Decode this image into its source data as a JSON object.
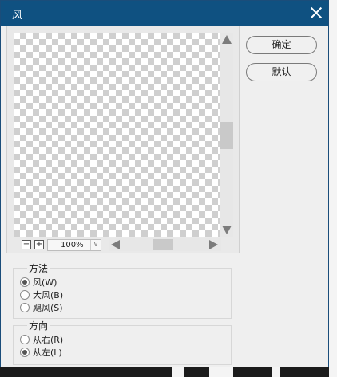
{
  "window": {
    "title": "风"
  },
  "preview": {
    "zoom": "100%",
    "zoom_out_symbol": "−",
    "zoom_in_symbol": "+"
  },
  "buttons": {
    "ok": "确定",
    "default": "默认"
  },
  "method_group": {
    "label": "方法",
    "options": [
      {
        "label": "风(W)",
        "checked": true
      },
      {
        "label": "大风(B)",
        "checked": false
      },
      {
        "label": "飓风(S)",
        "checked": false
      }
    ]
  },
  "direction_group": {
    "label": "方向",
    "options": [
      {
        "label": "从右(R)",
        "checked": false
      },
      {
        "label": "从左(L)",
        "checked": true
      }
    ]
  }
}
